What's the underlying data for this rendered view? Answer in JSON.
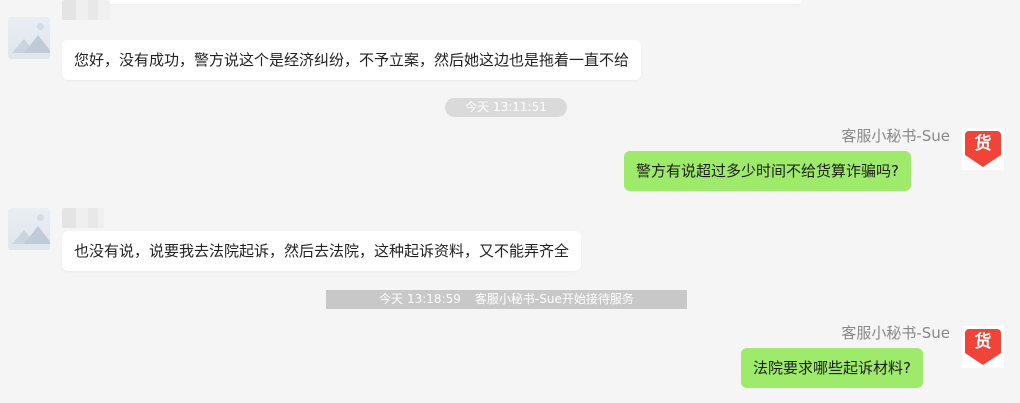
{
  "messages": [
    {
      "side": "left",
      "text": "您好，没有成功，警方说这个是经济纠纷，不予立案，然后她这边也是拖着一直不给"
    },
    {
      "side": "right",
      "sender": "客服小秘书-Sue",
      "text": "警方有说超过多少时间不给货算诈骗吗?"
    },
    {
      "side": "left",
      "text": "也没有说，说要我去法院起诉，然后去法院，这种起诉资料，又不能弄齐全"
    },
    {
      "side": "right",
      "sender": "客服小秘书-Sue",
      "text": "法院要求哪些起诉材料?"
    }
  ],
  "timestamp_1": "今天 13:11:51",
  "service_bar": {
    "time": "今天 13:18:59",
    "text": "客服小秘书-Sue开始接待服务"
  },
  "agent_avatar_glyph": "货",
  "colors": {
    "right_bubble": "#9eea6a",
    "left_bubble": "#ffffff",
    "badge": "#f04438",
    "background": "#f5f5f5"
  }
}
